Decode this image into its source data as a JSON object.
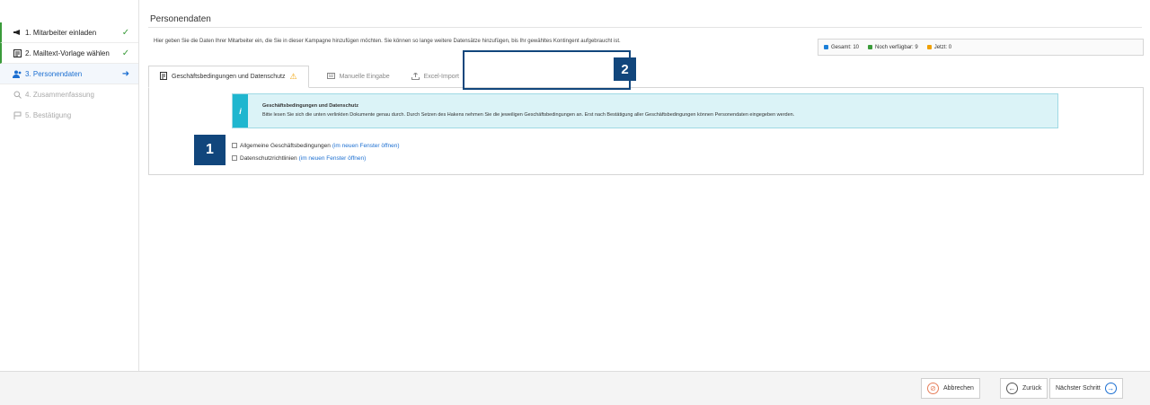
{
  "sidebar": {
    "steps": [
      {
        "label": "1. Mitarbeiter einladen",
        "status": "✓",
        "icon": "megaphone-icon"
      },
      {
        "label": "2. Mailtext-Vorlage wählen",
        "status": "✓",
        "icon": "template-icon"
      },
      {
        "label": "3. Personendaten",
        "status": "➜",
        "icon": "users-icon"
      },
      {
        "label": "4. Zusammenfassung",
        "status": "",
        "icon": "search-icon"
      },
      {
        "label": "5. Bestätigung",
        "status": "",
        "icon": "flag-icon"
      }
    ]
  },
  "main": {
    "title": "Personendaten",
    "intro": "Hier geben Sie die Daten Ihrer Mitarbeiter ein, die Sie in dieser Kampagne hinzufügen möchten. Sie können so lange weitere Datensätze hinzufügen, bis Ihr gewähltes Kontingent aufgebraucht ist.",
    "stats": [
      {
        "label": "Gesamt: 10",
        "color": "#1c7fd8"
      },
      {
        "label": "Noch verfügbar: 9",
        "color": "#3a9b3a"
      },
      {
        "label": "Jetzt: 0",
        "color": "#f0a000"
      }
    ],
    "tabs": [
      {
        "label": "Geschäftsbedingungen und Datenschutz",
        "icon": "document-icon",
        "warning": "⚠"
      },
      {
        "label": "Manuelle Eingabe",
        "icon": "keyboard-icon"
      },
      {
        "label": "Excel-Import",
        "icon": "upload-icon"
      }
    ],
    "info": {
      "title": "Geschäftsbedingungen und Datenschutz",
      "text": "Bitte lesen Sie sich die unten verlinkten Dokumente genau durch. Durch Setzen des Hakens nehmen Sie die jeweiligen Geschäftsbedingungen an. Erst nach Bestätigung aller Geschäftsbedingungen können Personendaten eingegeben werden.",
      "icon_char": "i"
    },
    "checks": [
      {
        "label": "Allgemeine Geschäftsbedingungen",
        "link": "(im neuen Fenster öffnen)"
      },
      {
        "label": "Datenschutzrichtlinien",
        "link": "(im neuen Fenster öffnen)"
      }
    ]
  },
  "markers": {
    "one": "1",
    "two": "2"
  },
  "footer": {
    "cancel": "Abbrechen",
    "back": "Zurück",
    "next": "Nächster Schritt"
  },
  "colors": {
    "accent": "#1c6fd1",
    "marker": "#11467c",
    "done": "#3a9b3a",
    "info_bar": "#1fb6cf"
  }
}
